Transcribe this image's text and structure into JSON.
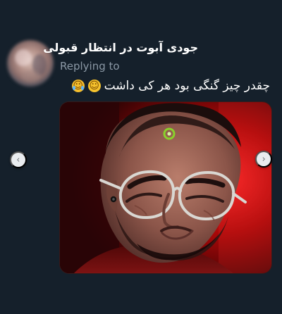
{
  "tweet": {
    "username": "جودی آبوت در انتظار قبولی",
    "replying_to": "Replying to",
    "text": "چقدر چیز گنگی بود هر کی داشت",
    "emojis": [
      "slightly-smiling-face-emoji",
      "face-with-tears-of-joy-emoji"
    ]
  },
  "media": {
    "controls": {
      "previous": "chevron-left-icon",
      "next": "chevron-right-icon"
    }
  }
}
